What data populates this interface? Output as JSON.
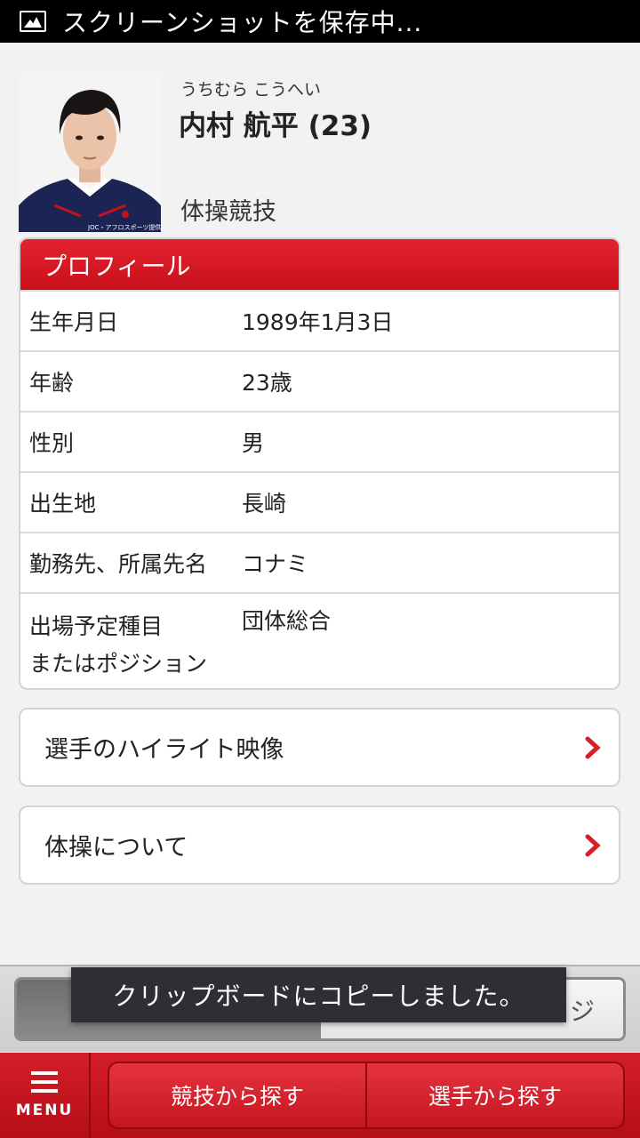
{
  "status_bar": {
    "icon": "image-icon",
    "text": "スクリーンショットを保存中..."
  },
  "athlete": {
    "kana": "うちむら こうへい",
    "name": "内村 航平 (23)",
    "sport": "体操競技",
    "photo_credit": "JOC・アフロスポーツ提供"
  },
  "profile": {
    "title": "プロフィール",
    "rows": [
      {
        "key": "生年月日",
        "value": "1989年1月3日"
      },
      {
        "key": "年齢",
        "value": "23歳"
      },
      {
        "key": "性別",
        "value": "男"
      },
      {
        "key": "出生地",
        "value": "長崎"
      },
      {
        "key": "勤務先、所属先名",
        "value": "コナミ"
      },
      {
        "key_line1": "出場予定種目",
        "key_line2": "またはポジション",
        "value": "団体総合"
      }
    ]
  },
  "links": [
    {
      "label": "選手のハイライト映像",
      "icon": "chevron-right-icon"
    },
    {
      "label": "体操について",
      "icon": "chevron-right-icon"
    }
  ],
  "segment": {
    "right_partial": "ジ"
  },
  "toast": "クリップボードにコピーしました。",
  "bottom_bar": {
    "menu_label": "MENU",
    "tab_1": "競技から探す",
    "tab_2": "選手から探す"
  },
  "colors": {
    "accent": "#d41e2a",
    "toast_bg": "#2d2f33"
  }
}
